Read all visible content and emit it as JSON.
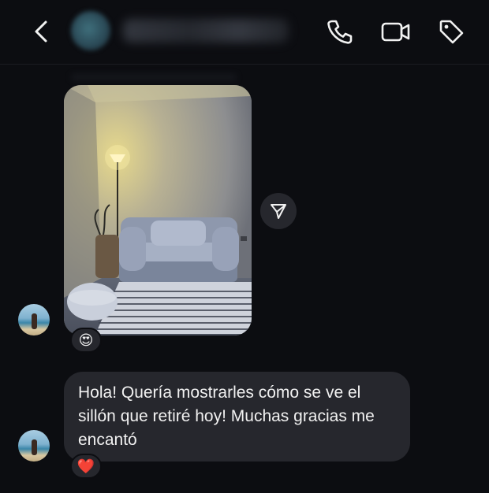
{
  "header": {
    "back_icon": "chevron-left-icon",
    "call_icon": "phone-icon",
    "video_icon": "video-camera-icon",
    "tag_icon": "tag-icon"
  },
  "messages": [
    {
      "type": "photo",
      "reaction": "😍",
      "share_icon": "paper-plane-icon"
    },
    {
      "type": "text",
      "text": "Hola! Quería mostrarles cómo se ve el sillón que retiré hoy! Muchas gracias me encantó",
      "reaction": "❤️"
    }
  ],
  "colors": {
    "background": "#0c0d11",
    "bubble": "#26272d",
    "text": "#f1f1f1"
  }
}
